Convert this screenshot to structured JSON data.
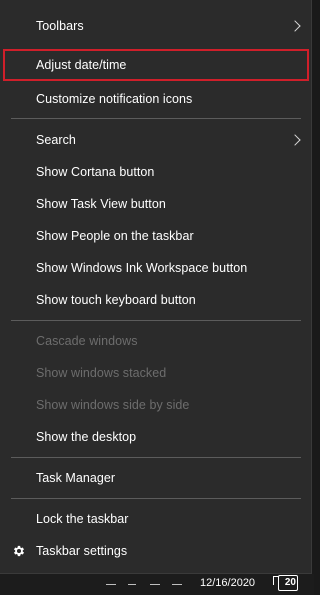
{
  "context_menu": {
    "toolbars": "Toolbars",
    "adjust_date_time": "Adjust date/time",
    "customize_notification_icons": "Customize notification icons",
    "search": "Search",
    "show_cortana_button": "Show Cortana button",
    "show_task_view_button": "Show Task View button",
    "show_people": "Show People on the taskbar",
    "show_ink_workspace": "Show Windows Ink Workspace button",
    "show_touch_keyboard": "Show touch keyboard button",
    "cascade_windows": "Cascade windows",
    "show_windows_stacked": "Show windows stacked",
    "show_windows_side_by_side": "Show windows side by side",
    "show_desktop": "Show the desktop",
    "task_manager": "Task Manager",
    "lock_taskbar": "Lock the taskbar",
    "taskbar_settings": "Taskbar settings"
  },
  "taskbar": {
    "date": "12/16/2020",
    "notification_count": "20"
  },
  "colors": {
    "menu_background": "#2b2b2b",
    "highlight_border": "#d01f2a",
    "disabled_text": "#6d6d6d"
  },
  "icons": {
    "submenu": "chevron-right-icon",
    "settings": "gear-icon"
  }
}
